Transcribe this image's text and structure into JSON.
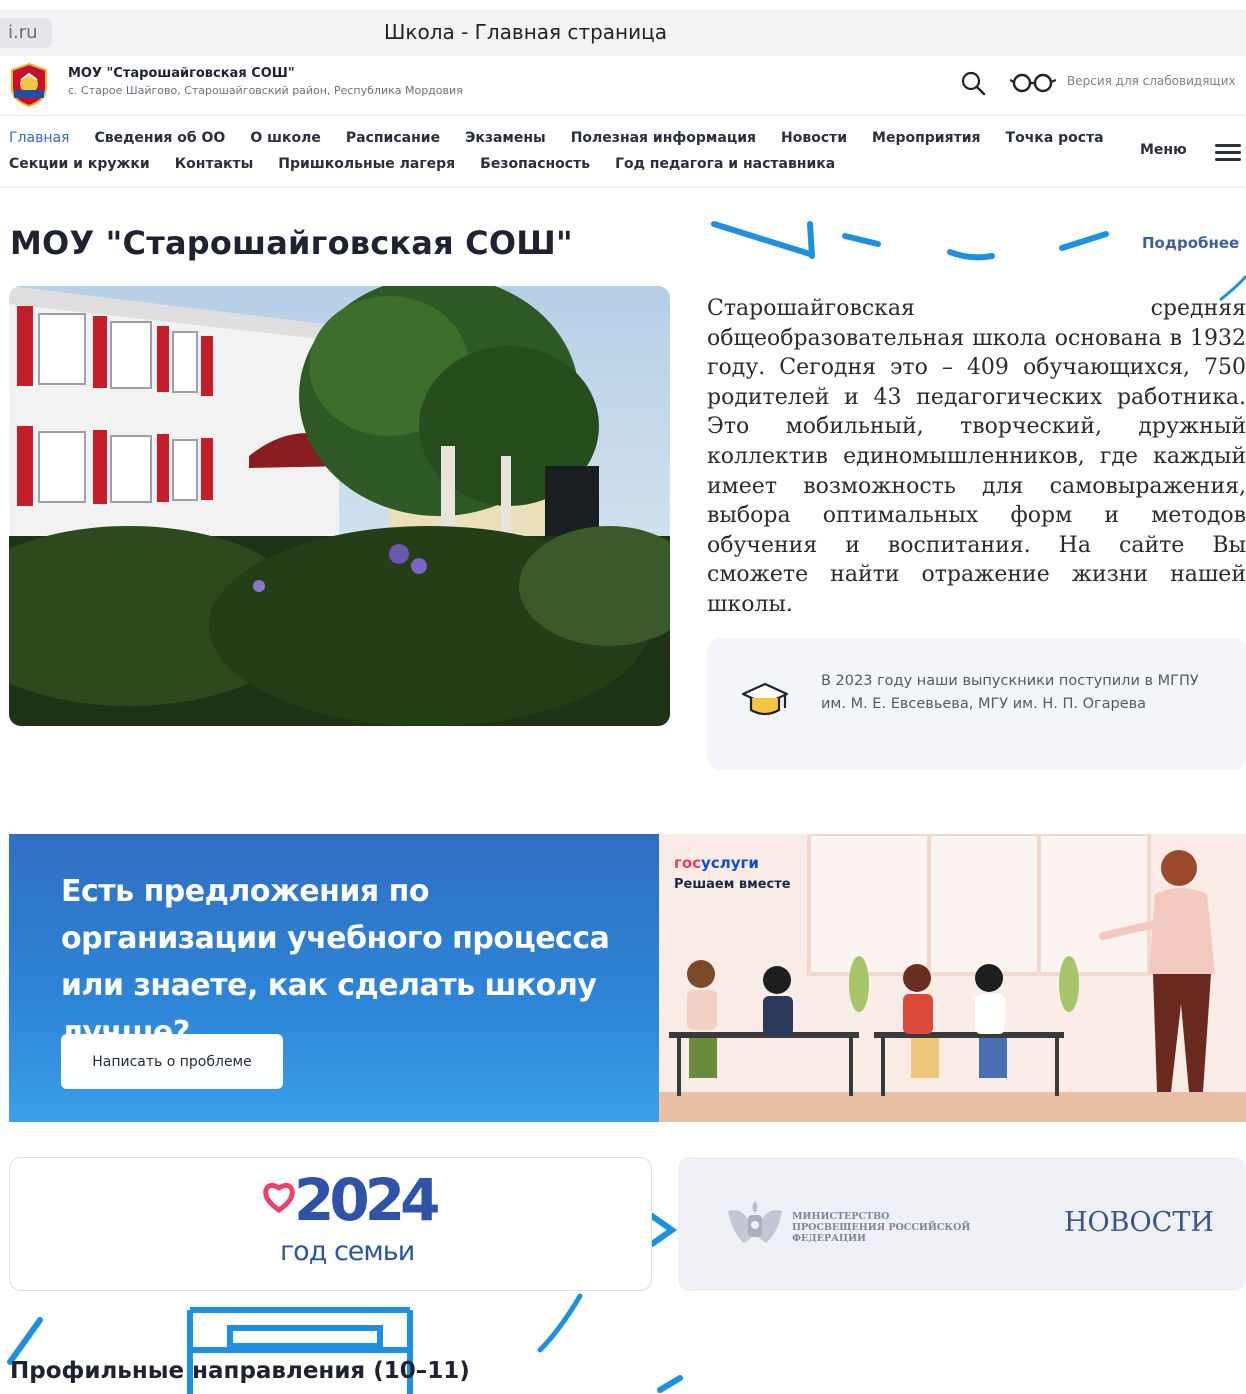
{
  "browser": {
    "url_fragment": "i.ru",
    "tab_title": "Школа - Главная страница"
  },
  "header": {
    "site_name": "МОУ \"Старошайговская СОШ\"",
    "address": "с. Старое Шайгово, Старошайговский район, Республика Мордовия",
    "low_vision_label": "Версия для слабовидящих"
  },
  "nav": {
    "row1": [
      {
        "label": "Главная",
        "active": true
      },
      {
        "label": "Сведения об ОО"
      },
      {
        "label": "О школе"
      },
      {
        "label": "Расписание"
      },
      {
        "label": "Экзамены"
      },
      {
        "label": "Полезная информация"
      },
      {
        "label": "Новости"
      },
      {
        "label": "Мероприятия"
      },
      {
        "label": "Точка роста"
      }
    ],
    "row2": [
      {
        "label": "Секции и кружки"
      },
      {
        "label": "Контакты"
      },
      {
        "label": "Пришкольные лагеря"
      },
      {
        "label": "Безопасность"
      },
      {
        "label": "Год педагога и наставника"
      }
    ],
    "menu_label": "Меню"
  },
  "hero": {
    "title": "МОУ \"Старошайговская СОШ\"",
    "more_link": "Подробнее",
    "intro": "Старошайговская средняя общеобразовательная школа основана в 1932 году. Сегодня это – 409 обучающихся, 750 родителей и 43 педагогических работника. Это мобильный, творческий, дружный коллектив единомышленников, где каждый имеет возможность для самовыражения, выбора оптимальных форм и методов обучения и воспитания. На сайте Вы сможете найти отражение жизни нашей школы.",
    "graduates": "В 2023 году наши выпускники поступили в МГПУ им. М. Е. Евсевьева, МГУ им. Н. П. Огарева"
  },
  "gos_banner": {
    "heading": "Есть предложения по организации учебного процесса или знаете, как сделать школу лучше?",
    "button": "Написать о проблеме",
    "brand_part1": "гос",
    "brand_part2": "услуги",
    "subtitle": "Решаем вместе"
  },
  "family_card": {
    "year": "2024",
    "caption": "год семьи"
  },
  "news_card": {
    "ministry": "МИНИСТЕРСТВО ПРОСВЕЩЕНИЯ РОССИЙСКОЙ ФЕДЕРАЦИИ",
    "label": "НОВОСТИ"
  },
  "profile": {
    "title": "Профильные направления (10–11)"
  },
  "colors": {
    "accent_blue": "#3366cc",
    "banner_blue": "#2f6fc2",
    "decor_blue": "#1e90e0",
    "gos_red": "#ee3f58",
    "gos_blue": "#0d4cd3"
  }
}
